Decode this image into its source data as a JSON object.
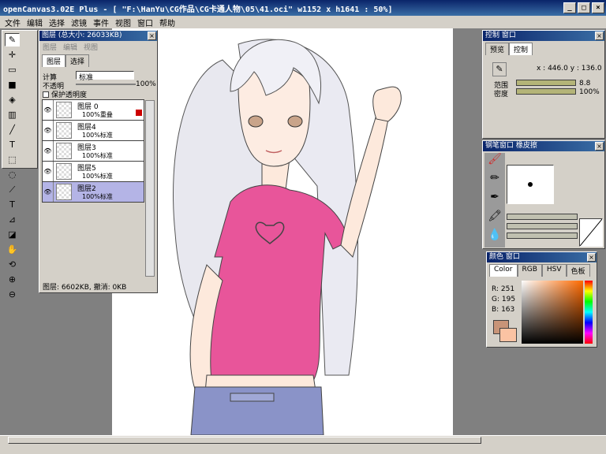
{
  "window": {
    "title": "openCanvas3.02E Plus - [ \"F:\\HanYu\\CG作品\\CG卡通人物\\05\\41.oci\" w1152 x h1641 : 50%]",
    "min": "_",
    "max": "□",
    "close": "×"
  },
  "menu": [
    "文件",
    "编辑",
    "选择",
    "滤镜",
    "事件",
    "视图",
    "窗口",
    "帮助"
  ],
  "layers_panel": {
    "title": "图层 (总大小: 26033KB)",
    "submenu": [
      "图层",
      "编辑",
      "视图"
    ],
    "tabs": [
      "图层",
      "选择"
    ],
    "calc_label": "计算",
    "calc_value": "标准",
    "opacity_label": "不透明",
    "opacity_value": "100%",
    "protect_label": "保护透明度",
    "layers": [
      {
        "name": "图层 0",
        "mode": "100%重叠"
      },
      {
        "name": "图层4",
        "mode": "100%标准"
      },
      {
        "name": "图层3",
        "mode": "100%标准"
      },
      {
        "name": "图层5",
        "mode": "100%标准"
      },
      {
        "name": "图层2",
        "mode": "100%标准"
      }
    ],
    "status": "图层: 6602KB, 撤消: 0KB"
  },
  "control_panel": {
    "title": "控制 窗口",
    "tabs": [
      "预览",
      "控制"
    ],
    "coords": "x : 446.0  y : 136.0",
    "range_label": "范围",
    "range_value": "8.8",
    "density_label": "密度",
    "density_value": "100%"
  },
  "brush_panel": {
    "title": "钢笔窗口   橡皮擦"
  },
  "color_panel": {
    "title": "颜色 窗口",
    "tabs": [
      "Color",
      "RGB",
      "HSV",
      "色板"
    ],
    "r": "R: 251",
    "g": "G: 195",
    "b": "B: 163",
    "fg": "#fbc3a3",
    "bg": "#c89478"
  }
}
